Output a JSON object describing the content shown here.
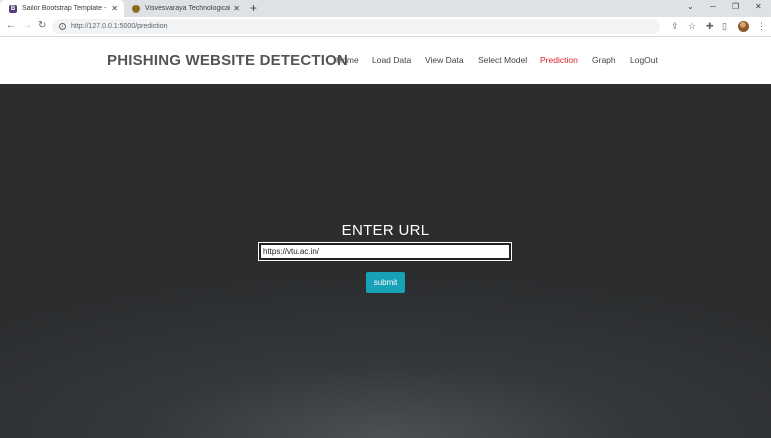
{
  "browser": {
    "tabs": [
      {
        "title": "Sailor Bootstrap Template - Index",
        "favicon": "bootstrap-icon"
      },
      {
        "title": "Visvesvaraya Technological Unive",
        "favicon": "vtu-shield-icon"
      }
    ],
    "url": "http://127.0.0.1:5000/prediction"
  },
  "site": {
    "brand": "PHISHING WEBSITE DETECTION",
    "menu": [
      {
        "label": "Home"
      },
      {
        "label": "Load Data"
      },
      {
        "label": "View Data"
      },
      {
        "label": "Select Model"
      },
      {
        "label": "Prediction",
        "active": true
      },
      {
        "label": "Graph"
      },
      {
        "label": "LogOut"
      }
    ],
    "active_color": "#d9232d"
  },
  "form": {
    "title": "ENTER URL",
    "url_value": "https://vtu.ac.in/",
    "submit_label": "submit",
    "submit_color": "#17a2b8"
  }
}
